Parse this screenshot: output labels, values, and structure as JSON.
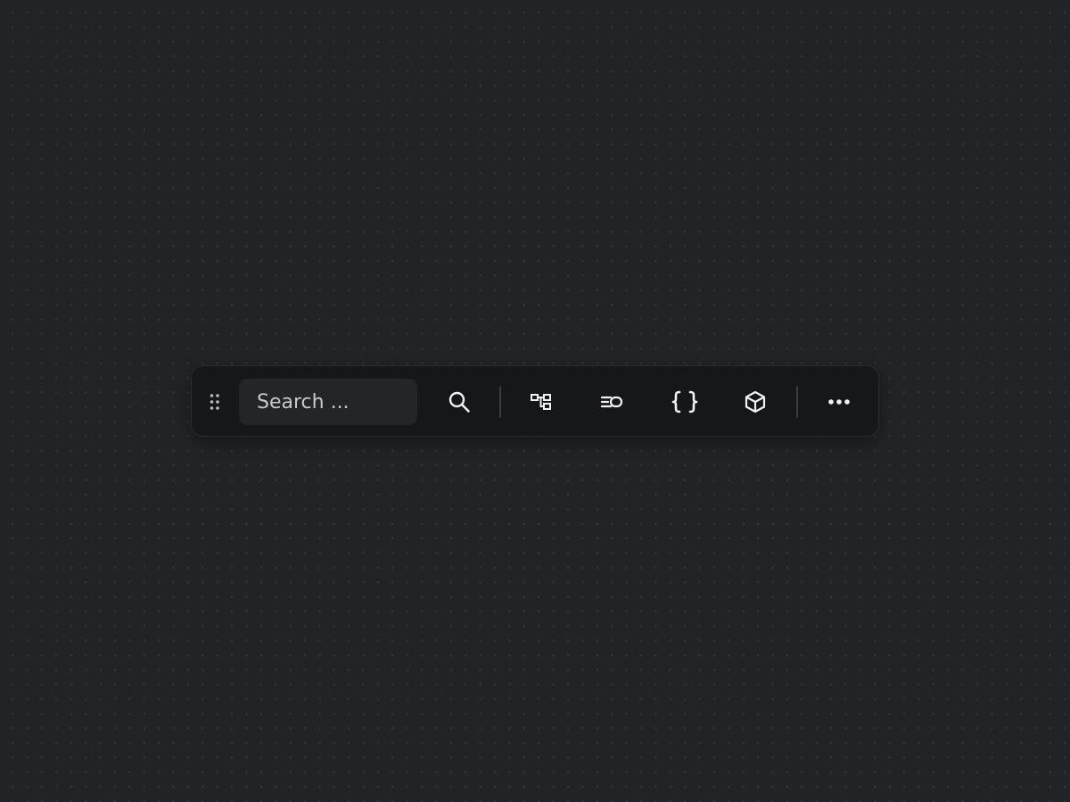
{
  "background": {
    "color": "#222326",
    "pattern": "dot-grid"
  },
  "toolbar": {
    "panel_color": "#161719",
    "icon_color": "#f2f2f2",
    "drag_handle_icon": "drag-dots-icon",
    "search": {
      "placeholder": "Search ...",
      "value": "",
      "icon": "search-icon"
    },
    "tools": [
      {
        "name": "hierarchy-tool",
        "icon": "hierarchy-icon"
      },
      {
        "name": "list-toggle-tool",
        "icon": "list-toggle-icon"
      },
      {
        "name": "code-braces-tool",
        "icon": "braces-icon"
      },
      {
        "name": "cube-tool",
        "icon": "cube-icon"
      }
    ],
    "more_icon": "more-horizontal-icon"
  }
}
